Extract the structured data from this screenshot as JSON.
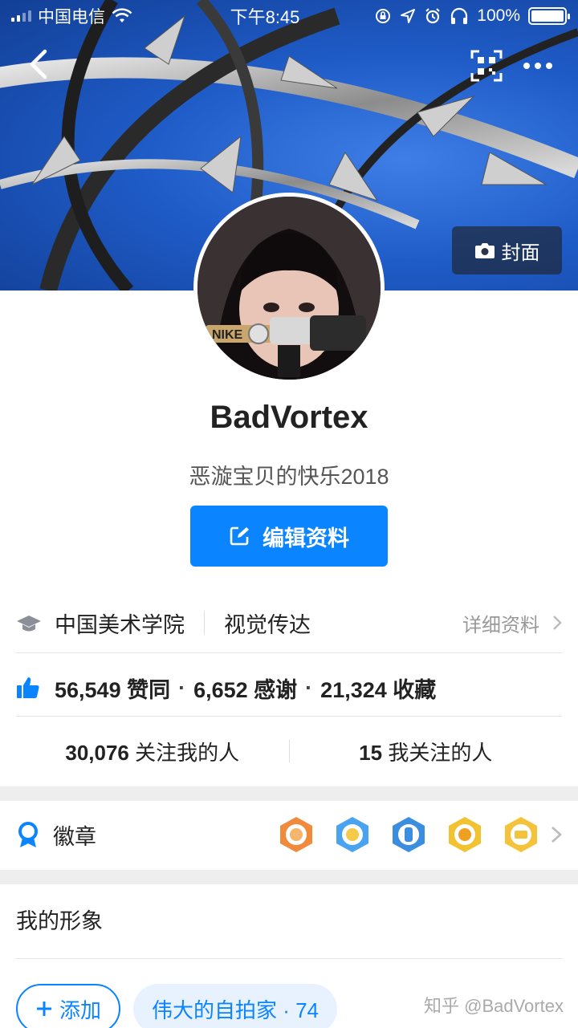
{
  "status_bar": {
    "carrier": "中国电信",
    "time": "下午8:45",
    "battery": "100%"
  },
  "cover": {
    "button_label": "封面"
  },
  "profile": {
    "name": "BadVortex",
    "bio": "恶漩宝贝的快乐2018",
    "edit_label": "编辑资料"
  },
  "education": {
    "school": "中国美术学院",
    "major": "视觉传达",
    "detail_label": "详细资料"
  },
  "stats": {
    "likes": "56,549 赞同",
    "thanks": "6,652 感谢",
    "favorites": "21,324 收藏",
    "separator": "·"
  },
  "follow": {
    "followers_count": "30,076",
    "followers_label": "关注我的人",
    "following_count": "15",
    "following_label": "我关注的人"
  },
  "badges": {
    "label": "徽章",
    "items": [
      "badge-1",
      "badge-2",
      "badge-3",
      "badge-4",
      "badge-5"
    ]
  },
  "image_section": {
    "title": "我的形象",
    "add_label": "添加",
    "tag_label": "伟大的自拍家 · 74"
  },
  "watermark": "知乎 @BadVortex",
  "colors": {
    "accent": "#0a84ff",
    "cover_sky": "#1f5cc8"
  }
}
